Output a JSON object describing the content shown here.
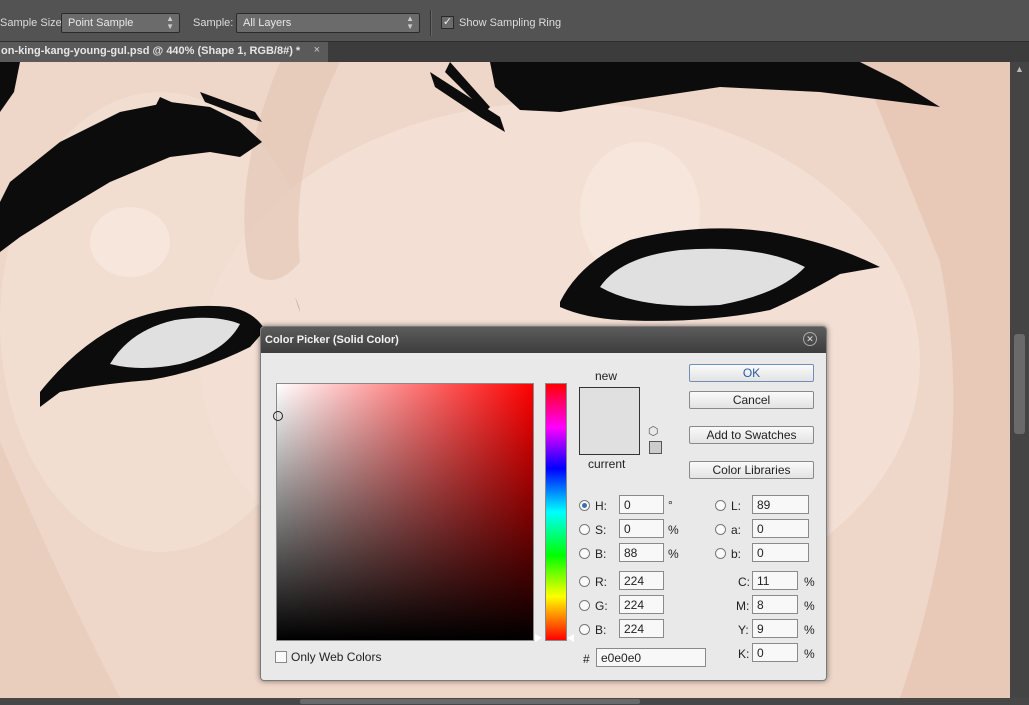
{
  "options_bar": {
    "sample_size_label": "Sample Size:",
    "sample_size_value": "Point Sample",
    "sample_label": "Sample:",
    "sample_value": "All Layers",
    "show_sampling_ring_label": "Show Sampling Ring",
    "show_sampling_ring_checked": true
  },
  "document_tab": {
    "title": "on-king-kang-young-gul.psd @ 440% (Shape 1, RGB/8#) *",
    "close_glyph": "×"
  },
  "color_picker": {
    "title": "Color Picker (Solid Color)",
    "new_label": "new",
    "current_label": "current",
    "new_color": "#e0e0e0",
    "current_color": "#e0e0e0",
    "buttons": {
      "ok": "OK",
      "cancel": "Cancel",
      "add_to_swatches": "Add to Swatches",
      "color_libraries": "Color Libraries"
    },
    "hsb": [
      {
        "label": "H:",
        "value": "0",
        "unit": "°",
        "selected": true
      },
      {
        "label": "S:",
        "value": "0",
        "unit": "%",
        "selected": false
      },
      {
        "label": "B:",
        "value": "88",
        "unit": "%",
        "selected": false
      }
    ],
    "rgb": [
      {
        "label": "R:",
        "value": "224"
      },
      {
        "label": "G:",
        "value": "224"
      },
      {
        "label": "B:",
        "value": "224"
      }
    ],
    "lab": [
      {
        "label": "L:",
        "value": "89"
      },
      {
        "label": "a:",
        "value": "0"
      },
      {
        "label": "b:",
        "value": "0"
      }
    ],
    "cmyk": [
      {
        "label": "C:",
        "value": "11",
        "unit": "%"
      },
      {
        "label": "M:",
        "value": "8",
        "unit": "%"
      },
      {
        "label": "Y:",
        "value": "9",
        "unit": "%"
      },
      {
        "label": "K:",
        "value": "0",
        "unit": "%"
      }
    ],
    "hex_label": "#",
    "hex_value": "e0e0e0",
    "only_web_colors_label": "Only Web Colors"
  }
}
